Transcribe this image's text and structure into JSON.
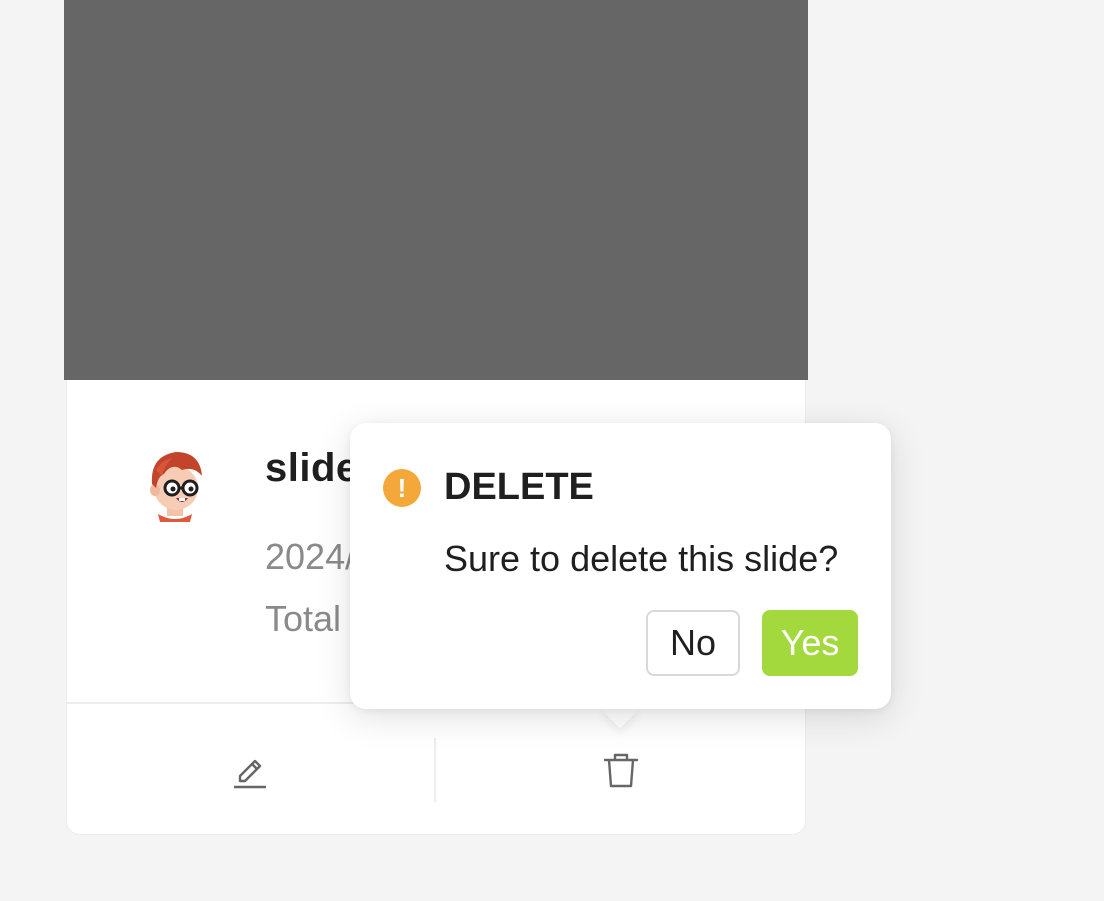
{
  "card": {
    "title": "slide",
    "date": "2024/",
    "total": "Total",
    "cover_color": "#666666"
  },
  "avatar": {
    "icon": "avatar-cartoon-boy-glasses"
  },
  "actions": {
    "edit_icon": "edit-icon",
    "delete_icon": "trash-icon"
  },
  "popconfirm": {
    "icon": "exclamation-circle-icon",
    "title": "DELETE",
    "message": "Sure to delete this slide?",
    "cancel_label": "No",
    "confirm_label": "Yes",
    "warn_color": "#f5a83a",
    "confirm_color": "#a3d93d"
  }
}
